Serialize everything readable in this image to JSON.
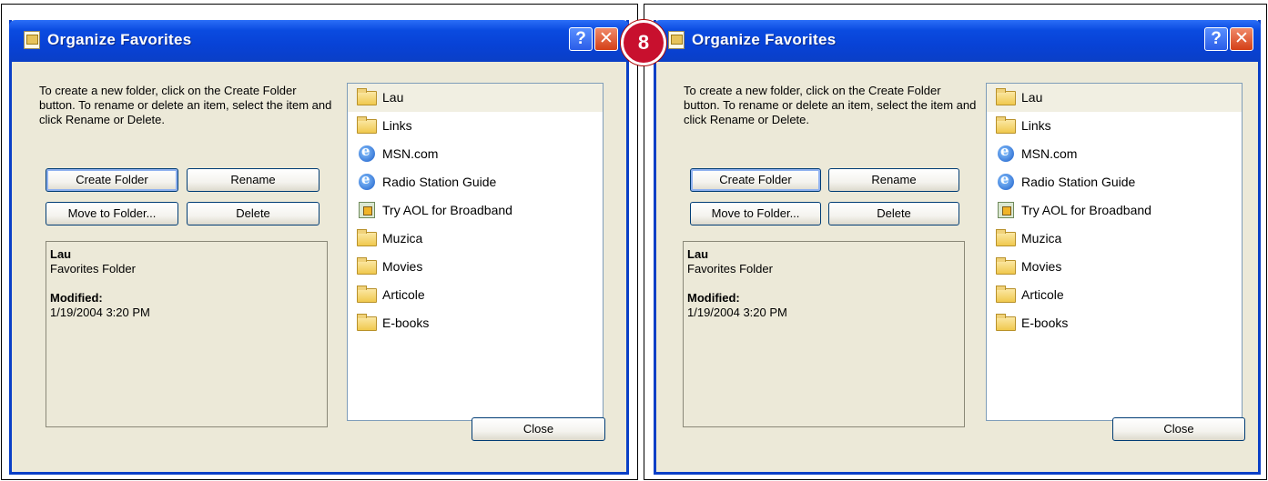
{
  "step_badge": "8",
  "dialogs": [
    {
      "title": "Organize Favorites",
      "help_glyph": "?",
      "close_glyph": "✕",
      "instructions": "To create a new folder, click on the Create Folder button. To rename or delete an item, select the item and click Rename or Delete.",
      "buttons": {
        "create_folder": "Create Folder",
        "rename": "Rename",
        "move_to_folder": "Move to Folder...",
        "delete": "Delete",
        "close": "Close"
      },
      "details": {
        "name": "Lau",
        "type": "Favorites Folder",
        "modified_label": "Modified:",
        "modified_value": "1/19/2004 3:20 PM"
      },
      "items": [
        {
          "label": "Lau",
          "icon": "folder-icon",
          "selected": true
        },
        {
          "label": "Links",
          "icon": "folder-icon"
        },
        {
          "label": "MSN.com",
          "icon": "ie-page-icon"
        },
        {
          "label": "Radio Station Guide",
          "icon": "ie-page-icon"
        },
        {
          "label": "Try AOL for Broadband",
          "icon": "aol-icon"
        },
        {
          "label": "Muzica",
          "icon": "folder-icon"
        },
        {
          "label": "Movies",
          "icon": "folder-icon"
        },
        {
          "label": "Articole",
          "icon": "folder-icon"
        },
        {
          "label": "E-books",
          "icon": "folder-icon"
        }
      ]
    },
    {
      "title": "Organize Favorites",
      "help_glyph": "?",
      "close_glyph": "✕",
      "instructions": "To create a new folder, click on the Create Folder button. To rename or delete an item, select the item and click Rename or Delete.",
      "buttons": {
        "create_folder": "Create Folder",
        "rename": "Rename",
        "move_to_folder": "Move to Folder...",
        "delete": "Delete",
        "close": "Close"
      },
      "details": {
        "name": "Lau",
        "type": "Favorites Folder",
        "modified_label": "Modified:",
        "modified_value": "1/19/2004 3:20 PM"
      },
      "items": [
        {
          "label": "Lau",
          "icon": "folder-icon",
          "selected": true
        },
        {
          "label": "Links",
          "icon": "folder-icon"
        },
        {
          "label": "MSN.com",
          "icon": "ie-page-icon"
        },
        {
          "label": "Radio Station Guide",
          "icon": "ie-page-icon"
        },
        {
          "label": "Try AOL for Broadband",
          "icon": "aol-icon"
        },
        {
          "label": "Muzica",
          "icon": "folder-icon"
        },
        {
          "label": "Movies",
          "icon": "folder-icon"
        },
        {
          "label": "Articole",
          "icon": "folder-icon"
        },
        {
          "label": "E-books",
          "icon": "folder-icon"
        }
      ]
    }
  ]
}
